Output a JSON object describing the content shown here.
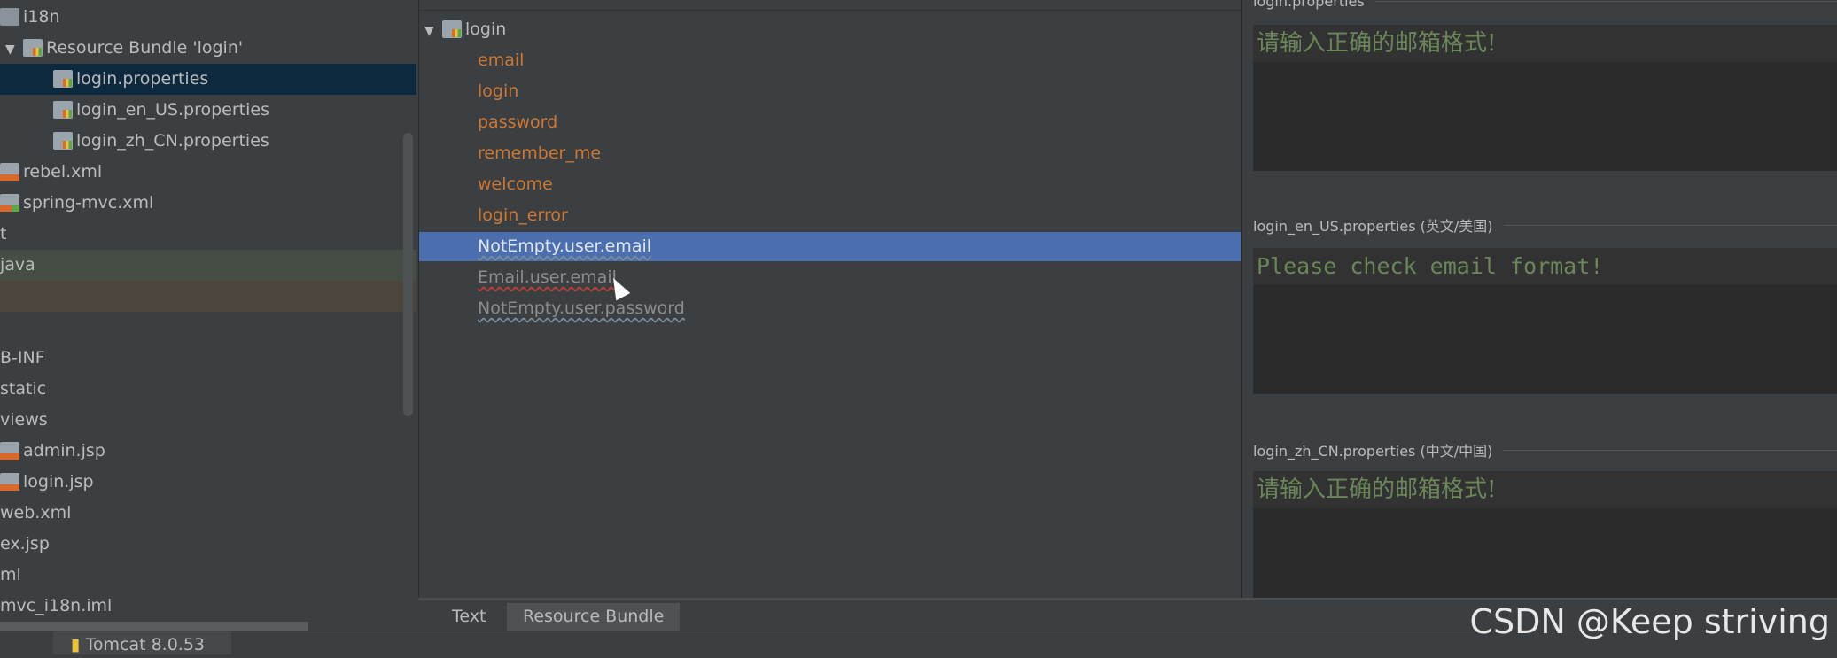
{
  "project_tree": {
    "items": [
      {
        "label": "i18n",
        "icon": "folder-icon",
        "type": "folder"
      },
      {
        "label": "Resource Bundle 'login'",
        "icon": "resource-bundle-icon",
        "type": "bundle",
        "expanded": true
      },
      {
        "label": "login.properties",
        "icon": "properties-file-icon",
        "type": "prop",
        "selected": true
      },
      {
        "label": "login_en_US.properties",
        "icon": "properties-file-icon",
        "type": "prop"
      },
      {
        "label": "login_zh_CN.properties",
        "icon": "properties-file-icon",
        "type": "prop"
      },
      {
        "label": "rebel.xml",
        "icon": "xml-file-icon",
        "type": "xml"
      },
      {
        "label": "spring-mvc.xml",
        "icon": "spring-xml-file-icon",
        "type": "xmls"
      },
      {
        "label": "t",
        "type": "text"
      },
      {
        "label": "java",
        "type": "text",
        "highlight": "green"
      },
      {
        "label": "",
        "type": "text",
        "highlight": "orange"
      },
      {
        "label": "",
        "type": "text"
      },
      {
        "label": "B-INF",
        "type": "text"
      },
      {
        "label": "static",
        "type": "text"
      },
      {
        "label": "views",
        "type": "text"
      },
      {
        "label": "admin.jsp",
        "icon": "jsp-file-icon",
        "type": "xml"
      },
      {
        "label": "login.jsp",
        "icon": "jsp-file-icon",
        "type": "xml"
      },
      {
        "label": "web.xml",
        "type": "text"
      },
      {
        "label": "ex.jsp",
        "type": "text"
      },
      {
        "label": "ml",
        "type": "text"
      },
      {
        "label": "mvc_i18n.iml",
        "type": "text"
      }
    ]
  },
  "bundle_keys": {
    "root": "login",
    "keys": [
      {
        "label": "email",
        "style": "normal"
      },
      {
        "label": "login",
        "style": "normal"
      },
      {
        "label": "password",
        "style": "normal"
      },
      {
        "label": "remember_me",
        "style": "normal"
      },
      {
        "label": "welcome",
        "style": "normal"
      },
      {
        "label": "login_error",
        "style": "normal"
      },
      {
        "label": "NotEmpty.user.email",
        "style": "selected"
      },
      {
        "label": "Email.user.email",
        "style": "grey-red"
      },
      {
        "label": "NotEmpty.user.password",
        "style": "grey"
      }
    ]
  },
  "editors": [
    {
      "header": "login.properties",
      "value": "请输入正确的邮箱格式!"
    },
    {
      "header": "login_en_US.properties (英文/美国)",
      "value": "Please check email format!"
    },
    {
      "header": "login_zh_CN.properties (中文/中国)",
      "value": "请输入正确的邮箱格式!"
    }
  ],
  "tabs": [
    {
      "label": "Text",
      "active": false
    },
    {
      "label": "Resource Bundle",
      "active": true
    }
  ],
  "status": {
    "run_config": "Tomcat 8.0.53"
  },
  "watermark": "CSDN @Keep striving",
  "colors": {
    "selection": "#4b6eaf",
    "key_orange": "#cc7832",
    "value_green": "#6a8759"
  }
}
